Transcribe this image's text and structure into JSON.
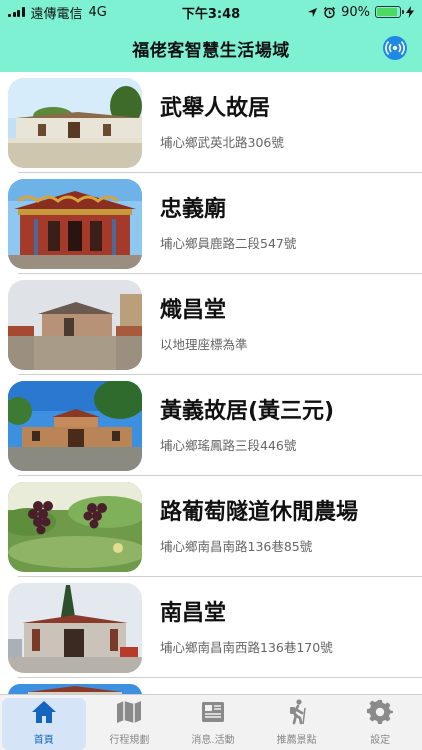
{
  "status": {
    "carrier": "遠傳電信",
    "network": "4G",
    "time": "下午3:48",
    "battery": "90%",
    "battery_level": 0.9
  },
  "header": {
    "title": "福佬客智慧生活場域",
    "right_icon": "broadcast-icon"
  },
  "places": [
    {
      "name": "武舉人故居",
      "address": "埔心鄉武英北路306號"
    },
    {
      "name": "忠義廟",
      "address": "埔心鄉員鹿路二段547號"
    },
    {
      "name": "熾昌堂",
      "address": "以地理座標為準"
    },
    {
      "name": "黃義故居(黃三元)",
      "address": "埔心鄉瑤鳳路三段446號"
    },
    {
      "name": "路葡萄隧道休閒農場",
      "address": "埔心鄉南昌南路136巷85號"
    },
    {
      "name": "南昌堂",
      "address": "埔心鄉南昌南西路136巷170號"
    }
  ],
  "tabs": [
    {
      "label": "首頁",
      "icon": "home-icon",
      "active": true
    },
    {
      "label": "行程規劃",
      "icon": "map-icon",
      "active": false
    },
    {
      "label": "消息.活動",
      "icon": "news-icon",
      "active": false
    },
    {
      "label": "推薦景點",
      "icon": "hiker-icon",
      "active": false
    },
    {
      "label": "設定",
      "icon": "gear-icon",
      "active": false
    }
  ],
  "colors": {
    "header_bg": "#7ef1d2",
    "tab_active": "#1565c0",
    "tab_inactive": "#888888",
    "accent_icon": "#1e88e5"
  }
}
